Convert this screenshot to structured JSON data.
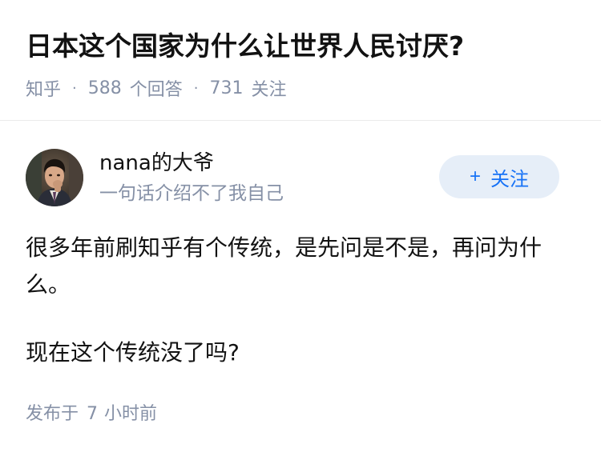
{
  "question": {
    "title": "日本这个国家为什么让世界人民讨厌?",
    "source": "知乎",
    "answer_count": "588",
    "answer_label": "个回答",
    "follower_count": "731",
    "follower_label": "关注",
    "separator": "·"
  },
  "author": {
    "avatar": "avatar-photo",
    "name": "nana的大爷",
    "bio": "一句话介绍不了我自己",
    "follow_label": "关注",
    "follow_icon": "+"
  },
  "content": {
    "paragraphs": [
      "很多年前刷知乎有个传统，是先问是不是，再问为什么。",
      "现在这个传统没了吗?"
    ]
  },
  "footer": {
    "published_prefix": "发布于",
    "published_num": "7",
    "published_suffix": "小时前"
  },
  "colors": {
    "accent": "#1772f6",
    "follow_bg": "#e6eef8",
    "meta_gray": "#8590a6",
    "text": "#121212"
  }
}
